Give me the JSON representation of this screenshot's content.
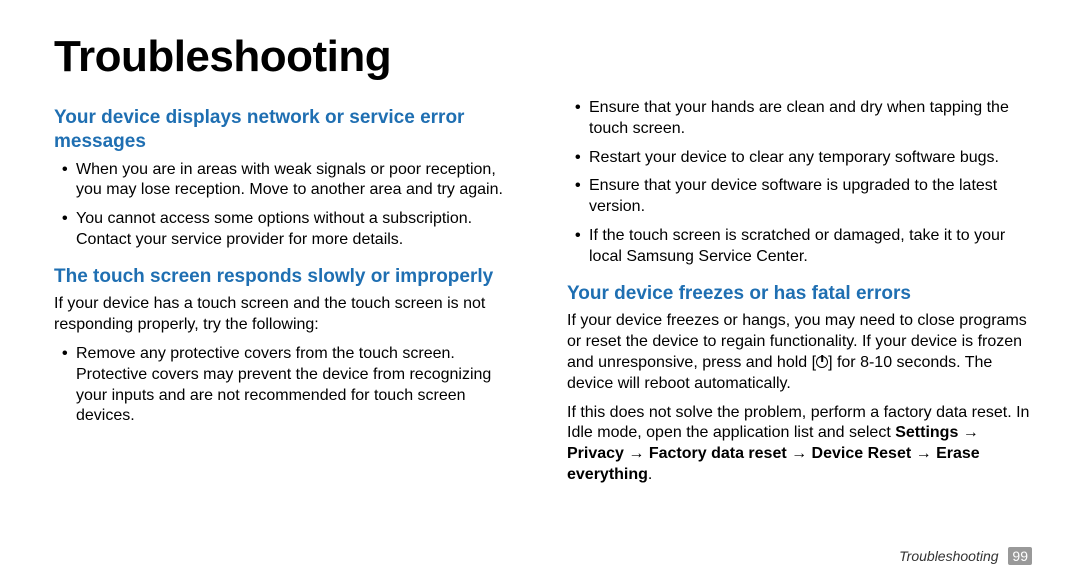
{
  "title": "Troubleshooting",
  "left": {
    "h1": "Your device displays network or service error messages",
    "b1": [
      "When you are in areas with weak signals or poor reception, you may lose reception. Move to another area and try again.",
      "You cannot access some options without a subscription. Contact your service provider for more details."
    ],
    "h2": "The touch screen responds slowly or improperly",
    "p2": "If your device has a touch screen and the touch screen is not responding properly, try the following:",
    "b2": [
      "Remove any protective covers from the touch screen. Protective covers may prevent the device from recognizing your inputs and are not recommended for touch screen devices."
    ]
  },
  "right": {
    "b0": [
      "Ensure that your hands are clean and dry when tapping the touch screen.",
      "Restart your device to clear any temporary software bugs.",
      "Ensure that your device software is upgraded to the latest version.",
      "If the touch screen is scratched or damaged, take it to your local Samsung Service Center."
    ],
    "h1": "Your device freezes or has fatal errors",
    "p1a": "If your device freezes or hangs, you may need to close programs or reset the device to regain functionality. If your device is frozen and unresponsive, press and hold [",
    "p1b": "] for 8-10 seconds. The device will reboot automatically.",
    "p2": "If this does not solve the problem, perform a factory data reset. In Idle mode, open the application list and select ",
    "p2bold": "Settings → Privacy → Factory data reset → Device Reset → Erase everything",
    "p2end": "."
  },
  "footer": {
    "section": "Troubleshooting",
    "page": "99"
  }
}
